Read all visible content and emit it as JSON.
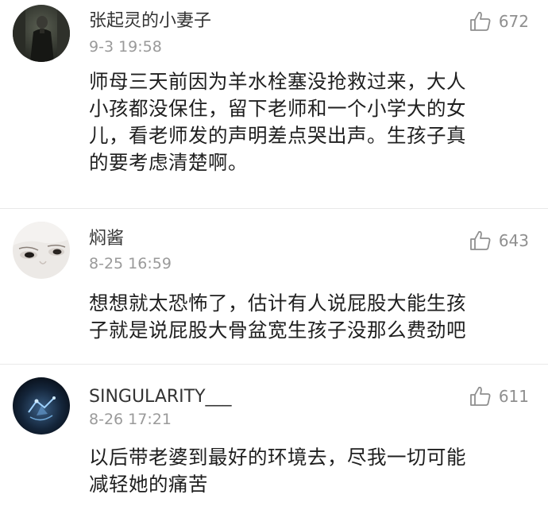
{
  "comments": [
    {
      "username": "张起灵的小妻子",
      "timestamp": "9-3 19:58",
      "likes": "672",
      "text": "师母三天前因为羊水栓塞没抢救过来，大人\n小孩都没保住，留下老师和一个小学大的女\n儿，看老师发的声明差点哭出声。生孩子真\n的要考虑清楚啊。",
      "avatar_icon": "dark-figure-avatar"
    },
    {
      "username": "焖酱",
      "timestamp": "8-25 16:59",
      "likes": "643",
      "text": "想想就太恐怖了，估计有人说屁股大能生孩\n子就是说屁股大骨盆宽生孩子没那么费劲吧",
      "avatar_icon": "face-closeup-avatar"
    },
    {
      "username": "SINGULARITY___",
      "timestamp": "8-26 17:21",
      "likes": "611",
      "text": "以后带老婆到最好的环境去，尽我一切可能\n减轻她的痛苦",
      "avatar_icon": "blue-light-avatar"
    }
  ],
  "colors": {
    "username": "#333333",
    "timestamp": "#9a9a9a",
    "body_text": "#1f1f1f",
    "like": "#8f8f8f",
    "divider": "#e9e9e9"
  },
  "icons": {
    "like": "thumbs-up-icon"
  }
}
